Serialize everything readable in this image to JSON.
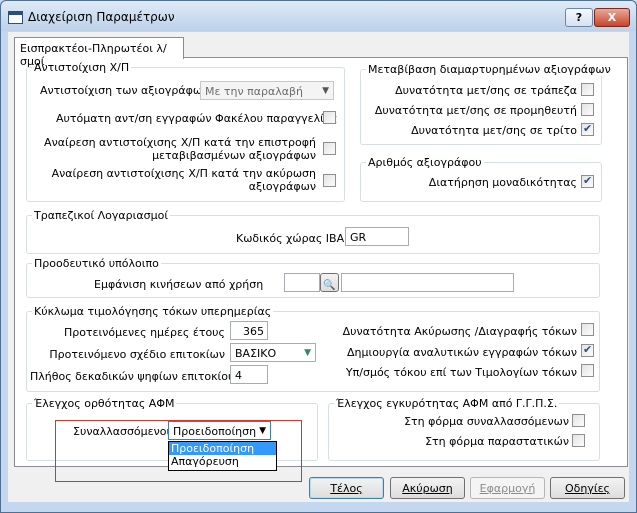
{
  "window": {
    "title": "Διαχείριση Παραμέτρων",
    "help_glyph": "?",
    "close_glyph": "X"
  },
  "tab": {
    "label": "Εισπρακτέοι-Πληρωτέοι λ/σμοί"
  },
  "grp_match": {
    "title": "Αντιστοίχιση Χ/Π",
    "match_label": "Αντιστοίχιση των αξιογράφων",
    "match_value": "Με την παραλαβή",
    "auto_label": "Αυτόματη αντ/ση εγγραφών Φακέλου παραγγελίας",
    "auto_checked": false,
    "undo_return_l1": "Αναίρεση αντιστοίχισης Χ/Π κατά την επιστροφή",
    "undo_return_l2": "μεταβιβασμένων αξιογράφων",
    "undo_return_checked": false,
    "undo_cancel_l1": "Αναίρεση αντιστοίχισης Χ/Π κατά την ακύρωση",
    "undo_cancel_l2": "αξιογράφων",
    "undo_cancel_checked": false
  },
  "grp_transfer": {
    "title": "Μεταβίβαση διαμαρτυρημένων αξιογράφων",
    "bank_label": "Δυνατότητα μετ/σης σε τράπεζα",
    "bank_checked": false,
    "supplier_label": "Δυνατότητα μετ/σης σε προμηθευτή",
    "supplier_checked": false,
    "third_label": "Δυνατότητα μετ/σης σε τρίτο",
    "third_checked": true
  },
  "grp_number": {
    "title": "Αριθμός αξιογράφου",
    "unique_label": "Διατήρηση μοναδικότητας",
    "unique_checked": true
  },
  "grp_bank": {
    "title": "Τραπεζικοί Λογαριασμοί",
    "iban_label": "Κωδικός χώρας IBAN",
    "iban_value": "GR"
  },
  "grp_balance": {
    "title": "Προοδευτικό υπόλοιπο",
    "show_label": "Εμφάνιση κινήσεων από χρήση",
    "year_value": "",
    "desc_value": ""
  },
  "grp_interest": {
    "title": "Κύκλωμα τιμολόγησης τόκων υπερημερίας",
    "days_label": "Προτεινόμενες ημέρες έτους",
    "days_value": "365",
    "scheme_label": "Προτεινόμενο σχέδιο επιτοκίων",
    "scheme_value": "ΒΑΣΙΚΟ",
    "decimals_label": "Πλήθος δεκαδικών ψηφίων επιτοκίου",
    "decimals_value": "4",
    "cancel_label": "Δυνατότητα Ακύρωσης /Διαγραφής τόκων",
    "cancel_checked": false,
    "analytic_label": "Δημιουργία αναλυτικών εγγραφών τόκων",
    "analytic_checked": true,
    "calc_label": "Υπ/σμός τόκου επί των Τιμολογίων τόκων",
    "calc_checked": false
  },
  "grp_afm": {
    "title": "Έλεγχος ορθότητας ΑΦΜ",
    "partners_label": "Συναλλασσόμενοι",
    "partners_value": "Προειδοποίηση",
    "options": [
      "Προειδοποίηση",
      "Απαγόρευση"
    ]
  },
  "grp_gsis": {
    "title": "Έλεγχος εγκυρότητας ΑΦΜ από Γ.Γ.Π.Σ.",
    "partners_form_label": "Στη φόρμα συναλλασσόμενων",
    "partners_form_checked": false,
    "docs_form_label": "Στη φόρμα παραστατικών",
    "docs_form_checked": false
  },
  "buttons": {
    "ok": "Τέλος",
    "cancel": "Ακύρωση",
    "apply": "Εφαρμογή",
    "help": "Οδηγίες"
  },
  "colors": {
    "highlight": "#d9332b",
    "selection": "#3399ff"
  }
}
